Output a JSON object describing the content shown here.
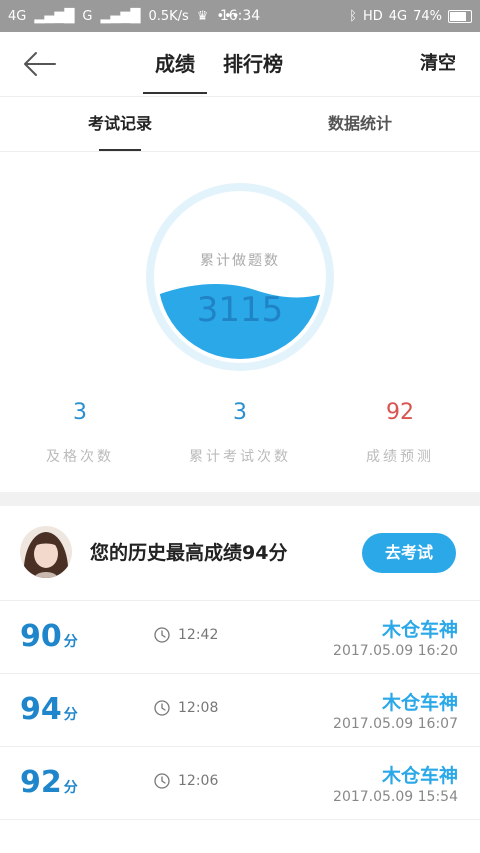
{
  "status_bar": {
    "left": [
      "4G",
      "G",
      "0.5K/s",
      "•••"
    ],
    "time": "16:34",
    "right": [
      "HD",
      "4G",
      "74%"
    ]
  },
  "nav": {
    "tabs": [
      {
        "label": "成绩",
        "active": true
      },
      {
        "label": "排行榜",
        "active": false
      }
    ],
    "clear": "清空"
  },
  "subtabs": [
    {
      "label": "考试记录",
      "active": true
    },
    {
      "label": "数据统计",
      "active": false
    }
  ],
  "gauge": {
    "label": "累计做题数",
    "value": "3115",
    "fill_fraction": 0.42
  },
  "stats": [
    {
      "value": "3",
      "label": "及格次数"
    },
    {
      "value": "3",
      "label": "累计考试次数"
    },
    {
      "value": "92",
      "label": "成绩预测"
    }
  ],
  "best": {
    "text": "您的历史最高成绩94分",
    "button": "去考试"
  },
  "records": [
    {
      "score": "90",
      "unit": "分",
      "time": "12:42",
      "name": "木仓车神",
      "date": "2017.05.09  16:20"
    },
    {
      "score": "94",
      "unit": "分",
      "time": "12:08",
      "name": "木仓车神",
      "date": "2017.05.09  16:07"
    },
    {
      "score": "92",
      "unit": "分",
      "time": "12:06",
      "name": "木仓车神",
      "date": "2017.05.09  15:54"
    }
  ],
  "colors": {
    "accent": "#2aa8e8",
    "score": "#1f86cc",
    "prediction": "#d9534f"
  }
}
